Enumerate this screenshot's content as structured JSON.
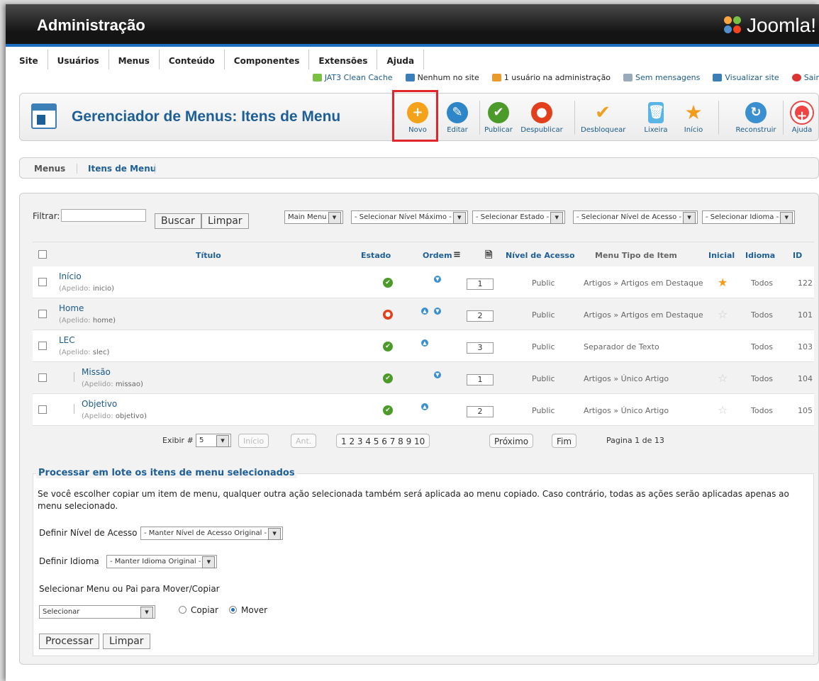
{
  "header": {
    "title": "Administração",
    "brand": "Joomla!"
  },
  "menu": [
    "Site",
    "Usuários",
    "Menus",
    "Conteúdo",
    "Componentes",
    "Extensões",
    "Ajuda"
  ],
  "status": [
    "JAT3 Clean Cache",
    "Nenhum no site",
    "1 usuário na administração",
    "Sem mensagens",
    "Visualizar site",
    "Sair"
  ],
  "toolbar": {
    "title": "Gerenciador de Menus: Itens de Menu",
    "buttons": [
      "Novo",
      "Editar",
      "Publicar",
      "Despublicar",
      "Desbloquear",
      "Lixeira",
      "Início",
      "Reconstruir",
      "Ajuda"
    ]
  },
  "tabs": [
    "Menus",
    "Itens de Menu"
  ],
  "filter": {
    "label": "Filtrar:",
    "value": "",
    "search": "Buscar",
    "clear": "Limpar",
    "selects": [
      "Main Menu",
      "- Selecionar Nível Máximo -",
      "- Selecionar Estado -",
      "- Selecionar Nível de Acesso -",
      "- Selecionar Idioma -"
    ]
  },
  "columns": [
    "Título",
    "Estado",
    "Ordem",
    "Nível de Acesso",
    "Menu Tipo de Item",
    "Inicial",
    "Idioma",
    "ID"
  ],
  "rows": [
    {
      "title": "Início",
      "alias_label": "(Apelido: ",
      "alias": "inicio)",
      "order": "1",
      "access": "Public",
      "type": "Artigos » Artigos em Destaque",
      "lang": "Todos",
      "id": "122"
    },
    {
      "title": "Home",
      "alias_label": "(Apelido: ",
      "alias": "home)",
      "order": "2",
      "access": "Public",
      "type": "Artigos » Artigos em Destaque",
      "lang": "Todos",
      "id": "101"
    },
    {
      "title": "LEC",
      "alias_label": "(Apelido: ",
      "alias": "slec)",
      "order": "3",
      "access": "Public",
      "type": "Separador de Texto",
      "lang": "Todos",
      "id": "103"
    },
    {
      "title": "Missão",
      "alias_label": "(Apelido: ",
      "alias": "missao)",
      "order": "1",
      "access": "Public",
      "type": "Artigos » Único Artigo",
      "lang": "Todos",
      "id": "104"
    },
    {
      "title": "Objetivo",
      "alias_label": "(Apelido: ",
      "alias": "objetivo)",
      "order": "2",
      "access": "Public",
      "type": "Artigos » Único Artigo",
      "lang": "Todos",
      "id": "105"
    }
  ],
  "pager": {
    "show_label": "Exibir #",
    "show_value": "5",
    "start": "Início",
    "prev": "Ant.",
    "pages": "1  2  3  4  5  6  7  8  9  10",
    "next": "Próximo",
    "end": "Fim",
    "info": "Pagina 1 de 13"
  },
  "batch": {
    "legend": "Processar em lote os itens de menu selecionados",
    "text": "Se você escolher copiar um item de menu, qualquer outra ação selecionada também será aplicada ao menu copiado. Caso contrário, todas as ações serão aplicadas apenas ao menu selecionado.",
    "access_label": "Definir Nível de Acesso",
    "access_value": "- Manter Nível de Acesso Original -",
    "lang_label": "Definir Idioma",
    "lang_value": "- Manter Idioma Original -",
    "move_label": "Selecionar Menu ou Pai para Mover/Copiar",
    "move_value": "Selecionar",
    "copy": "Copiar",
    "move": "Mover",
    "process": "Processar",
    "clear": "Limpar"
  }
}
